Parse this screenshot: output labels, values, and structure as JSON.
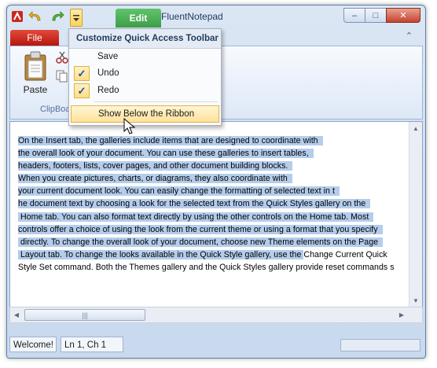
{
  "window": {
    "title": "FluentNotepad",
    "context_tab": "Edit"
  },
  "qat": {
    "app_icon": "app-icon",
    "undo_icon": "undo-icon",
    "redo_icon": "redo-icon",
    "dropdown_icon": "qat-dropdown-icon"
  },
  "caption_buttons": {
    "minimize": "–",
    "maximize": "□",
    "close": "✕"
  },
  "ribbon": {
    "file_tab": "File",
    "minimize_glyph": "⌃",
    "paste_label": "Paste",
    "group_label": "ClipBoa"
  },
  "menu": {
    "header": "Customize Quick Access Toolbar",
    "items": [
      {
        "label": "Save",
        "checked": false
      },
      {
        "label": "Undo",
        "checked": true,
        "check_glyph": "✓"
      },
      {
        "label": "Redo",
        "checked": true,
        "check_glyph": "✓"
      },
      {
        "label": "Show Below the Ribbon",
        "highlighted": true
      }
    ]
  },
  "document": {
    "lines": [
      {
        "sel": "On the Insert tab, the galleries include items that are designed to coordinate with  ",
        "rest": ""
      },
      {
        "sel": "the overall look of your document. You can use these galleries to insert tables,  ",
        "rest": ""
      },
      {
        "sel": "headers, footers, lists, cover pages, and other document building blocks.  ",
        "rest": ""
      },
      {
        "sel": "When you create pictures, charts, or diagrams, they also coordinate with  ",
        "rest": ""
      },
      {
        "sel": "your current document look. You can easily change the formatting of selected text in t  ",
        "rest": ""
      },
      {
        "sel": "he document text by choosing a look for the selected text from the Quick Styles gallery on the  ",
        "rest": ""
      },
      {
        "sel": " Home tab. You can also format text directly by using the other controls on the Home tab. Most  ",
        "rest": ""
      },
      {
        "sel": "controls offer a choice of using the look from the current theme or using a format that you specify  ",
        "rest": ""
      },
      {
        "sel": " directly. To change the overall look of your document, choose new Theme elements on the Page  ",
        "rest": ""
      },
      {
        "sel": " Layout tab. To change the looks available in the Quick Style gallery, use the ",
        "rest": "Change Current Quick"
      },
      {
        "sel": "",
        "rest": "Style Set command. Both the Themes gallery and the Quick Styles gallery provide reset commands s"
      }
    ],
    "selection_color": "#b4cdec"
  },
  "scroll": {
    "up": "▲",
    "down": "▼",
    "left": "◀",
    "right": "▶",
    "thumb_grip": "|||"
  },
  "status": {
    "message": "Welcome!",
    "position": "Ln 1, Ch 1",
    "progress": 0
  },
  "colors": {
    "accent": "#3f9d49",
    "file_tab": "#c4261a",
    "highlight": "#ffe29a"
  }
}
